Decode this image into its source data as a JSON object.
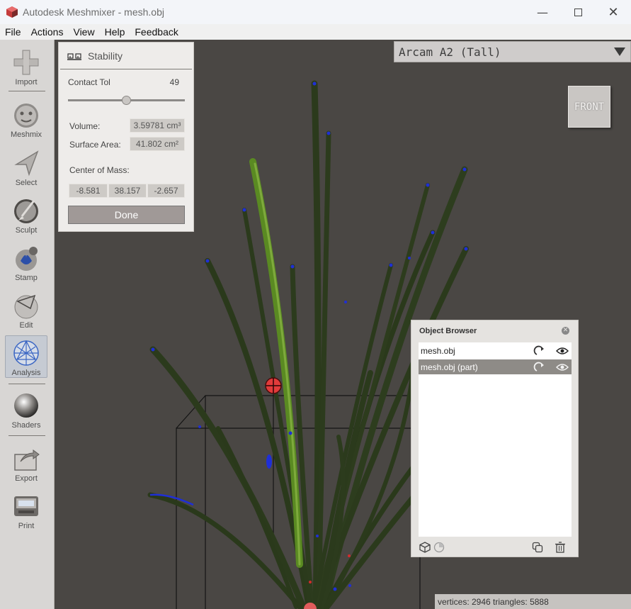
{
  "window": {
    "title": "Autodesk Meshmixer - mesh.obj",
    "controls": [
      "minimize-icon",
      "maximize-icon",
      "close-icon"
    ]
  },
  "menu": [
    "File",
    "Actions",
    "View",
    "Help",
    "Feedback"
  ],
  "toolbar": {
    "tools": [
      {
        "label": "Import",
        "icon": "plus-icon"
      },
      {
        "label": "Meshmix",
        "icon": "bunny-head-icon"
      },
      {
        "label": "Select",
        "icon": "arrow-cursor-icon"
      },
      {
        "label": "Sculpt",
        "icon": "brush-icon"
      },
      {
        "label": "Stamp",
        "icon": "stamp-icon"
      },
      {
        "label": "Edit",
        "icon": "edit-sphere-icon"
      },
      {
        "label": "Analysis",
        "icon": "analysis-sphere-icon",
        "active": true
      },
      {
        "label": "Shaders",
        "icon": "shader-ball-icon"
      },
      {
        "label": "Export",
        "icon": "export-icon"
      },
      {
        "label": "Print",
        "icon": "printer-icon"
      }
    ]
  },
  "printer": {
    "selected": "Arcam A2 (Tall)"
  },
  "viewcube": {
    "face": "FRONT"
  },
  "stability": {
    "title": "Stability",
    "contact_tol_label": "Contact Tol",
    "contact_tol_value": "49",
    "slider_fraction": 0.5,
    "volume_label": "Volume:",
    "volume_value": "3.59781 cm³",
    "surface_area_label": "Surface Area:",
    "surface_area_value": "41.802 cm²",
    "center_of_mass_label": "Center of Mass:",
    "center_of_mass": [
      "-8.581",
      "38.157",
      "-2.657"
    ],
    "done_label": "Done"
  },
  "object_browser": {
    "title": "Object Browser",
    "items": [
      {
        "name": "mesh.obj",
        "selected": false
      },
      {
        "name": "mesh.obj (part)",
        "selected": true
      }
    ]
  },
  "status": {
    "text": "vertices: 2946 triangles: 5888"
  },
  "colors": {
    "viewport_bg": "#4a4744",
    "grass_dark": "#2b3a1c",
    "grass_light": "#5a8a22",
    "edge_marker": "#1f2fd6",
    "com_marker": "#e23b3b"
  }
}
